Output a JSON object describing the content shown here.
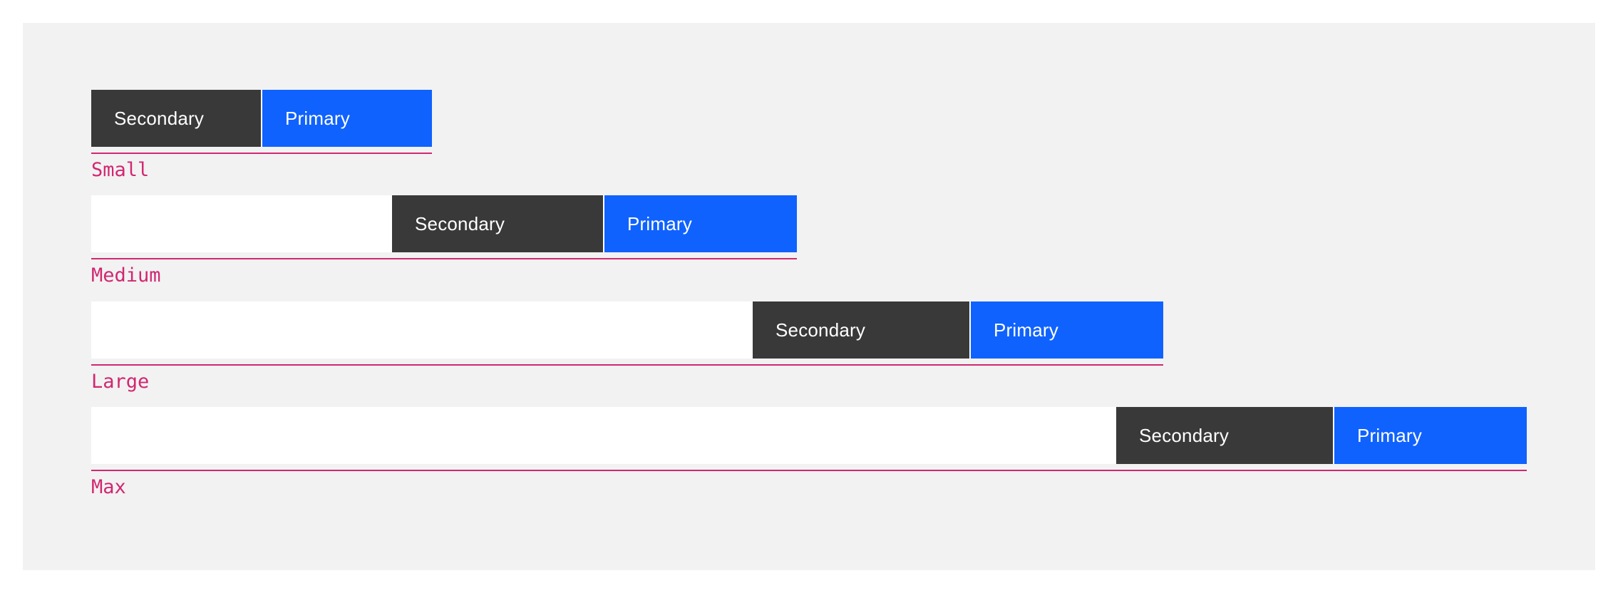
{
  "colors": {
    "background": "#f2f2f2",
    "secondary_button": "#393939",
    "primary_button": "#0f62fe",
    "annotation": "#d12771"
  },
  "rows": [
    {
      "label": "Small",
      "secondary_label": "Secondary",
      "primary_label": "Primary"
    },
    {
      "label": "Medium",
      "secondary_label": "Secondary",
      "primary_label": "Primary"
    },
    {
      "label": "Large",
      "secondary_label": "Secondary",
      "primary_label": "Primary"
    },
    {
      "label": "Max",
      "secondary_label": "Secondary",
      "primary_label": "Primary"
    }
  ]
}
